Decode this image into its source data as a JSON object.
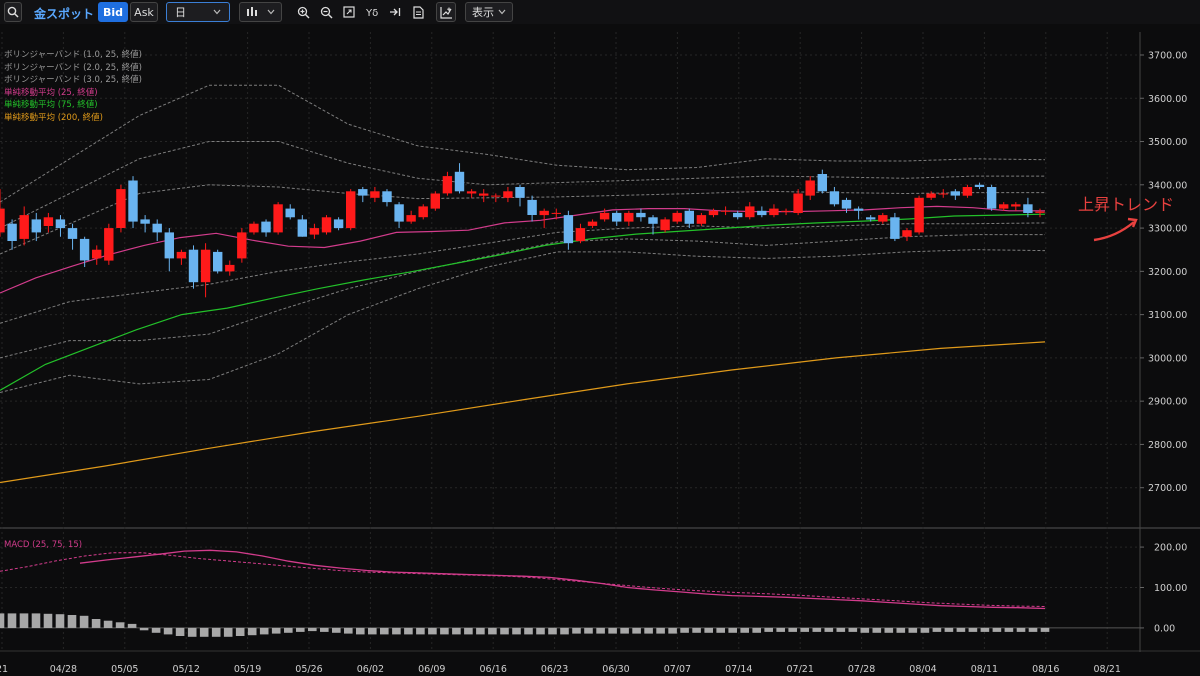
{
  "toolbar": {
    "instrument": "金スポット",
    "bid_label": "Bid",
    "ask_label": "Ask",
    "timeframe": "日",
    "display_label": "表示",
    "icons": [
      "search-icon",
      "candle-type-icon",
      "zoom-in-icon",
      "zoom-out-icon",
      "fit-icon",
      "indicator-icon",
      "jump-latest-icon",
      "notes-icon",
      "chart-settings-icon",
      "chevron-down-icon"
    ]
  },
  "legend": [
    {
      "text": "ボリンジャーバンド (1.0, 25, 終値)",
      "color": "#9a9a9a"
    },
    {
      "text": "ボリンジャーバンド (2.0, 25, 終値)",
      "color": "#9a9a9a"
    },
    {
      "text": "ボリンジャーバンド (3.0, 25, 終値)",
      "color": "#9a9a9a"
    },
    {
      "text": "単純移動平均 (25, 終値)",
      "color": "#d23c8c"
    },
    {
      "text": "単純移動平均 (75, 終値)",
      "color": "#23c12a"
    },
    {
      "text": "単純移動平均 (200, 終値)",
      "color": "#e09a1a"
    }
  ],
  "annotation": "上昇トレンド",
  "colors": {
    "up": "#ff1a1a",
    "down": "#6ab4f0",
    "sma25": "#d23c8c",
    "sma75": "#23c12a",
    "sma200": "#e09a1a",
    "band": "#7d7d7d",
    "macd_hist": "#a8a8a8"
  },
  "chart_data": {
    "type": "candlestick",
    "x_labels": [
      "21",
      "04/28",
      "05/05",
      "05/12",
      "05/19",
      "05/26",
      "06/02",
      "06/09",
      "06/16",
      "06/23",
      "06/30",
      "07/07",
      "07/14",
      "07/21",
      "07/28",
      "08/04",
      "08/11",
      "08/16",
      "08/21"
    ],
    "y_ticks": [
      2700,
      2800,
      2900,
      3000,
      3100,
      3200,
      3300,
      3400,
      3500,
      3600,
      3700
    ],
    "y_tick_labels": [
      "2700.00",
      "2800.00",
      "2900.00",
      "3000.00",
      "3100.00",
      "3200.00",
      "3300.00",
      "3400.00",
      "3500.00",
      "3600.00",
      "3700.00"
    ],
    "ylim": [
      2630,
      3730
    ],
    "candles": [
      [
        3290,
        3345,
        3280,
        3390
      ],
      [
        3310,
        3270,
        3250,
        3320
      ],
      [
        3275,
        3330,
        3260,
        3350
      ],
      [
        3320,
        3290,
        3270,
        3335
      ],
      [
        3305,
        3325,
        3290,
        3335
      ],
      [
        3320,
        3300,
        3280,
        3330
      ],
      [
        3300,
        3275,
        3250,
        3310
      ],
      [
        3275,
        3225,
        3210,
        3280
      ],
      [
        3230,
        3250,
        3215,
        3260
      ],
      [
        3225,
        3300,
        3215,
        3310
      ],
      [
        3300,
        3390,
        3290,
        3400
      ],
      [
        3410,
        3315,
        3300,
        3420
      ],
      [
        3320,
        3310,
        3290,
        3330
      ],
      [
        3310,
        3290,
        3270,
        3320
      ],
      [
        3290,
        3230,
        3200,
        3300
      ],
      [
        3230,
        3245,
        3215,
        3250
      ],
      [
        3250,
        3175,
        3160,
        3260
      ],
      [
        3175,
        3250,
        3140,
        3265
      ],
      [
        3245,
        3200,
        3195,
        3250
      ],
      [
        3200,
        3215,
        3190,
        3225
      ],
      [
        3230,
        3290,
        3220,
        3300
      ],
      [
        3290,
        3310,
        3285,
        3315
      ],
      [
        3315,
        3290,
        3280,
        3320
      ],
      [
        3290,
        3355,
        3285,
        3360
      ],
      [
        3345,
        3325,
        3320,
        3355
      ],
      [
        3320,
        3280,
        3280,
        3330
      ],
      [
        3285,
        3300,
        3275,
        3310
      ],
      [
        3290,
        3325,
        3285,
        3330
      ],
      [
        3320,
        3300,
        3295,
        3325
      ],
      [
        3300,
        3385,
        3295,
        3390
      ],
      [
        3390,
        3375,
        3360,
        3395
      ],
      [
        3370,
        3385,
        3360,
        3395
      ],
      [
        3385,
        3360,
        3350,
        3390
      ],
      [
        3355,
        3315,
        3300,
        3360
      ],
      [
        3315,
        3330,
        3310,
        3340
      ],
      [
        3325,
        3350,
        3320,
        3355
      ],
      [
        3345,
        3380,
        3340,
        3385
      ],
      [
        3380,
        3420,
        3375,
        3430
      ],
      [
        3430,
        3385,
        3380,
        3450
      ],
      [
        3380,
        3385,
        3370,
        3390
      ],
      [
        3375,
        3380,
        3360,
        3390
      ],
      [
        3375,
        3375,
        3360,
        3380
      ],
      [
        3370,
        3385,
        3360,
        3395
      ],
      [
        3395,
        3370,
        3350,
        3400
      ],
      [
        3365,
        3330,
        3315,
        3375
      ],
      [
        3330,
        3340,
        3300,
        3345
      ],
      [
        3335,
        3335,
        3320,
        3345
      ],
      [
        3330,
        3265,
        3250,
        3340
      ],
      [
        3270,
        3300,
        3265,
        3310
      ],
      [
        3305,
        3315,
        3300,
        3320
      ],
      [
        3320,
        3335,
        3315,
        3345
      ],
      [
        3335,
        3315,
        3305,
        3340
      ],
      [
        3315,
        3335,
        3305,
        3340
      ],
      [
        3335,
        3325,
        3315,
        3345
      ],
      [
        3325,
        3310,
        3285,
        3330
      ],
      [
        3295,
        3320,
        3290,
        3325
      ],
      [
        3315,
        3335,
        3310,
        3340
      ],
      [
        3340,
        3310,
        3300,
        3345
      ],
      [
        3310,
        3330,
        3305,
        3335
      ],
      [
        3330,
        3340,
        3325,
        3345
      ],
      [
        3340,
        3340,
        3330,
        3350
      ],
      [
        3335,
        3325,
        3320,
        3340
      ],
      [
        3325,
        3350,
        3320,
        3360
      ],
      [
        3340,
        3330,
        3325,
        3350
      ],
      [
        3330,
        3345,
        3325,
        3355
      ],
      [
        3340,
        3340,
        3330,
        3345
      ],
      [
        3335,
        3380,
        3330,
        3390
      ],
      [
        3375,
        3410,
        3365,
        3420
      ],
      [
        3425,
        3385,
        3380,
        3435
      ],
      [
        3385,
        3355,
        3350,
        3395
      ],
      [
        3365,
        3345,
        3335,
        3370
      ],
      [
        3345,
        3340,
        3320,
        3350
      ],
      [
        3325,
        3320,
        3315,
        3330
      ],
      [
        3315,
        3330,
        3310,
        3335
      ],
      [
        3325,
        3275,
        3270,
        3335
      ],
      [
        3280,
        3295,
        3270,
        3300
      ],
      [
        3290,
        3370,
        3285,
        3375
      ],
      [
        3370,
        3380,
        3365,
        3385
      ],
      [
        3380,
        3380,
        3370,
        3390
      ],
      [
        3385,
        3375,
        3365,
        3390
      ],
      [
        3375,
        3395,
        3370,
        3400
      ],
      [
        3400,
        3395,
        3390,
        3405
      ],
      [
        3395,
        3345,
        3340,
        3400
      ],
      [
        3345,
        3355,
        3340,
        3360
      ],
      [
        3350,
        3355,
        3340,
        3360
      ],
      [
        3355,
        3335,
        3325,
        3370
      ],
      [
        3335,
        3338,
        3325,
        3345
      ]
    ],
    "sma25": [
      3150,
      3185,
      3212,
      3238,
      3260,
      3278,
      3288,
      3272,
      3258,
      3255,
      3270,
      3290,
      3292,
      3295,
      3312,
      3318,
      3330,
      3342,
      3345,
      3345,
      3340,
      3338,
      3338,
      3340,
      3342,
      3347,
      3350,
      3347,
      3340,
      3340
    ],
    "sma75": [
      2925,
      2985,
      3025,
      3065,
      3100,
      3115,
      3138,
      3160,
      3180,
      3198,
      3218,
      3238,
      3260,
      3275,
      3286,
      3293,
      3300,
      3307,
      3312,
      3316,
      3321,
      3328,
      3330,
      3332
    ],
    "sma200": [
      2712,
      2750,
      2791,
      2830,
      2865,
      2903,
      2940,
      2972,
      3000,
      3022,
      3037
    ],
    "bb_upper3": [
      3360,
      3460,
      3560,
      3630,
      3630,
      3540,
      3490,
      3470,
      3445,
      3435,
      3440,
      3460,
      3455,
      3455,
      3460,
      3458
    ],
    "bb_upper2": [
      3300,
      3380,
      3460,
      3500,
      3500,
      3450,
      3415,
      3400,
      3405,
      3410,
      3415,
      3420,
      3418,
      3415,
      3420,
      3420
    ],
    "bb_upper1": [
      3240,
      3310,
      3380,
      3400,
      3395,
      3380,
      3368,
      3370,
      3372,
      3376,
      3380,
      3385,
      3382,
      3380,
      3382,
      3382
    ],
    "bb_lower1": [
      3080,
      3130,
      3150,
      3170,
      3200,
      3222,
      3240,
      3265,
      3290,
      3300,
      3305,
      3300,
      3305,
      3310,
      3310,
      3312
    ],
    "bb_lower2": [
      3000,
      3040,
      3040,
      3055,
      3110,
      3160,
      3200,
      3235,
      3268,
      3275,
      3270,
      3260,
      3270,
      3280,
      3285,
      3285
    ],
    "bb_lower3": [
      2920,
      2960,
      2940,
      2950,
      3010,
      3100,
      3160,
      3210,
      3245,
      3245,
      3235,
      3230,
      3235,
      3245,
      3250,
      3248
    ],
    "macd": {
      "label": "MACD (25, 75, 15)",
      "y_ticks": [
        0,
        100,
        200
      ],
      "y_tick_labels": [
        "0.00",
        "100.00",
        "200.00"
      ],
      "ylim": [
        -15,
        215
      ],
      "macd": [
        160,
        168,
        175,
        182,
        190,
        192,
        188,
        178,
        165,
        155,
        148,
        142,
        138,
        136,
        134,
        132,
        130,
        128,
        125,
        118,
        110,
        100,
        94,
        89,
        84,
        80,
        78,
        76,
        73,
        70,
        67,
        63,
        59,
        55,
        53,
        51,
        50,
        48
      ],
      "signal": [
        140,
        152,
        166,
        178,
        186,
        186,
        180,
        172,
        166,
        160,
        154,
        148,
        142,
        138,
        136,
        134,
        132,
        130,
        128,
        124,
        118,
        112,
        106,
        100,
        95,
        91,
        88,
        85,
        82,
        78,
        74,
        70,
        66,
        62,
        59,
        56,
        54,
        53
      ],
      "histogram": [
        36,
        36,
        36,
        36,
        35,
        34,
        32,
        30,
        22,
        18,
        14,
        10,
        -6,
        -12,
        -16,
        -20,
        -22,
        -22,
        -22,
        -22,
        -20,
        -18,
        -16,
        -14,
        -12,
        -10,
        -8,
        -10,
        -12,
        -14,
        -16,
        -16,
        -16,
        -16,
        -16,
        -16,
        -16,
        -16,
        -16,
        -16,
        -16,
        -16,
        -16,
        -16,
        -16,
        -16,
        -16,
        -16,
        -14,
        -14,
        -14,
        -14,
        -14,
        -14,
        -14,
        -14,
        -14,
        -12,
        -12,
        -12,
        -12,
        -12,
        -12,
        -12,
        -10,
        -10,
        -10,
        -10,
        -10,
        -10,
        -10,
        -10,
        -12,
        -12,
        -12,
        -12,
        -12,
        -12,
        -10,
        -10,
        -10,
        -10,
        -10,
        -10,
        -10,
        -10,
        -10,
        -10
      ]
    }
  }
}
